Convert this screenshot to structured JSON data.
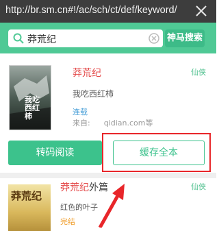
{
  "browser": {
    "url": "http://br.sm.cn#!/ac/sch/ct/def/keyword/"
  },
  "search": {
    "query": "莽荒纪",
    "button_label": "神马搜索"
  },
  "results": [
    {
      "title_highlight": "莽荒纪",
      "title_suffix": "",
      "category": "仙侠",
      "author": "我吃西红柿",
      "status": "连载",
      "source_label": "来自:",
      "source_value": "qidian.com等",
      "cover_text": "我吃西红柿"
    },
    {
      "title_highlight": "莽荒纪",
      "title_suffix": "外篇",
      "category": "仙侠",
      "author": "红色的叶子",
      "status": "完结",
      "cover_text": "莽荒纪"
    }
  ],
  "actions": {
    "read_label": "转码阅读",
    "cache_label": "缓存全本"
  },
  "colors": {
    "accent": "#4fc995",
    "highlight_box": "#e8262a",
    "title_highlight": "#e44a4a",
    "url_bar": "#3d3d3d"
  },
  "icons": {
    "close": "close-icon",
    "search": "search-icon",
    "clear": "clear-icon"
  }
}
